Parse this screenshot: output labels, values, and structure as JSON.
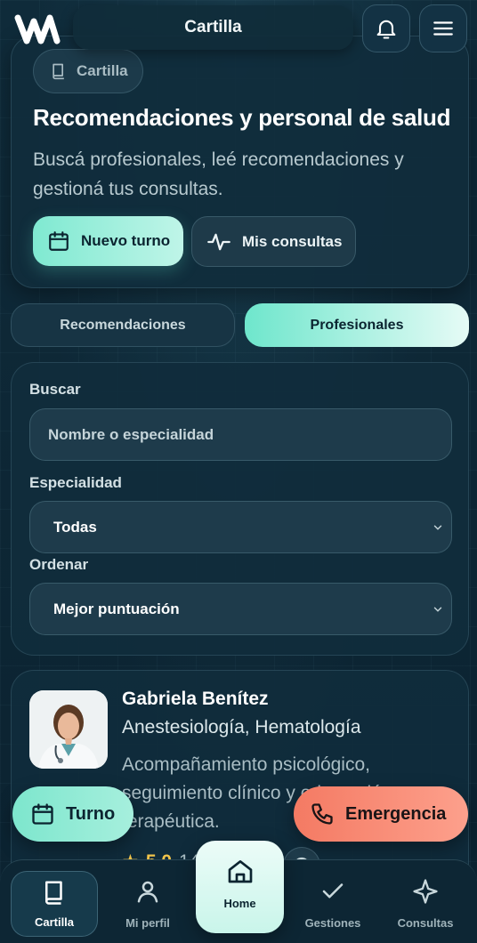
{
  "header": {
    "title": "Cartilla",
    "bell_icon": "bell-icon",
    "menu_icon": "menu-icon"
  },
  "hero": {
    "chip_label": "Cartilla",
    "title": "Recomendaciones y personal de salud",
    "subtitle": "Buscá profesionales, leé recomendaciones y gestioná tus consultas.",
    "primary_button": "Nuevo turno",
    "secondary_button": "Mis consultas"
  },
  "tabs": [
    {
      "label": "Recomendaciones",
      "active": false
    },
    {
      "label": "Profesionales",
      "active": true
    }
  ],
  "filters": {
    "search_label": "Buscar",
    "search_placeholder": "Nombre o especialidad",
    "specialty_label": "Especialidad",
    "specialty_value": "Todas",
    "order_label": "Ordenar",
    "order_value": "Mejor puntuación"
  },
  "professional": {
    "name": "Gabriela Benítez",
    "specialties": "Anestesiología, Hematología",
    "description": "Acompañamiento psicológico, seguimiento clínico y orientación terapéutica.",
    "rating": "5.0",
    "reviews": "14 opiniones"
  },
  "fabs": {
    "turno": "Turno",
    "emergencia": "Emergencia"
  },
  "bottom_nav": [
    {
      "label": "Cartilla",
      "icon": "book-icon",
      "active": true
    },
    {
      "label": "Mi perfil",
      "icon": "user-icon",
      "active": false
    },
    {
      "label": "Home",
      "icon": "home-icon",
      "active": false
    },
    {
      "label": "Gestiones",
      "icon": "check-icon",
      "active": false
    },
    {
      "label": "Consultas",
      "icon": "sparkle-icon",
      "active": false
    }
  ],
  "colors": {
    "background": "#0c2330",
    "card": "#102d3c",
    "accent": "#7fe9d1",
    "emergency": "#f47a63"
  }
}
